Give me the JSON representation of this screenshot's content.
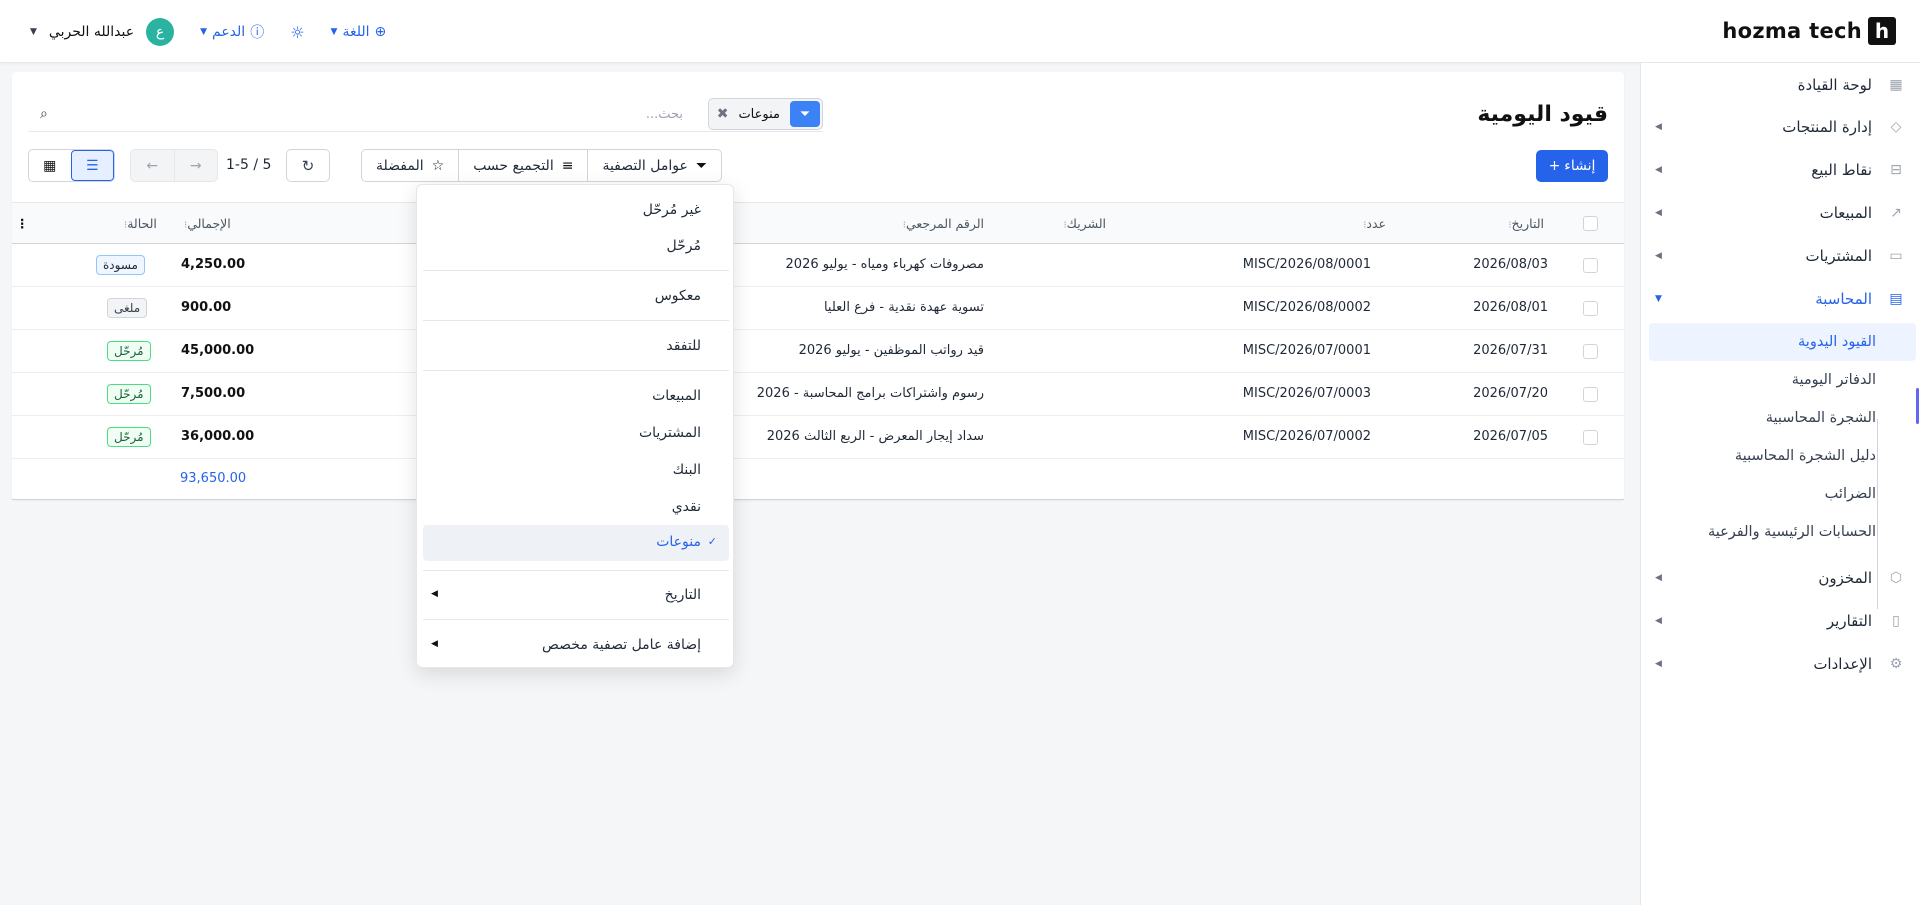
{
  "brand": {
    "name": "hozma tech",
    "mark": "h"
  },
  "topbar": {
    "user_name": "عبدالله الحربي",
    "avatar_letter": "ع",
    "support_label": "الدعم",
    "language_label": "اللغة"
  },
  "sidebar": {
    "items": [
      {
        "label": "لوحة القيادة",
        "icon": "dashboard-icon"
      },
      {
        "label": "إدارة المنتجات",
        "icon": "tag-icon"
      },
      {
        "label": "نقاط البيع",
        "icon": "store-icon"
      },
      {
        "label": "المبيعات",
        "icon": "chart-icon"
      },
      {
        "label": "المشتريات",
        "icon": "wallet-icon"
      },
      {
        "label": "المحاسبة",
        "icon": "ledger-icon"
      },
      {
        "label": "المخزون",
        "icon": "box-icon"
      },
      {
        "label": "التقارير",
        "icon": "report-icon"
      },
      {
        "label": "الإعدادات",
        "icon": "gear-icon"
      }
    ],
    "accounting_sub": [
      "القيود اليدوية",
      "الدفاتر اليومية",
      "الشجرة المحاسبية",
      "دليل الشجرة المحاسبية",
      "الضرائب",
      "الحسابات الرئيسية والفرعية"
    ]
  },
  "page": {
    "title": "قيود اليومية",
    "search_placeholder": "بحث...",
    "facet_value": "منوعات",
    "create_label": "إنشاء",
    "filters_label": "عوامل التصفية",
    "group_by_label": "التجميع حسب",
    "favorites_label": "المفضلة",
    "pager": "1-5 / 5"
  },
  "table": {
    "headers": {
      "date": "التاريخ",
      "number": "عدد",
      "partner": "الشريك",
      "ref": "الرقم المرجعي",
      "total": "الإجمالي",
      "status": "الحالة"
    },
    "rows": [
      {
        "date": "2026/08/03",
        "number": "MISC/2026/08/0001",
        "ref": "مصروفات كهرباء ومياه - يوليو 2026",
        "total": "4,250.00",
        "status": "مسودة",
        "status_kind": "draft"
      },
      {
        "date": "2026/08/01",
        "number": "MISC/2026/08/0002",
        "ref": "تسوية عهدة نقدية - فرع العليا",
        "total": "900.00",
        "status": "ملغى",
        "status_kind": "cancel"
      },
      {
        "date": "2026/07/31",
        "number": "MISC/2026/07/0001",
        "ref": "قيد رواتب الموظفين - يوليو 2026",
        "total": "45,000.00",
        "status": "مُرحّل",
        "status_kind": "posted"
      },
      {
        "date": "2026/07/20",
        "number": "MISC/2026/07/0003",
        "ref": "رسوم واشتراكات برامج المحاسبة - 2026",
        "total": "7,500.00",
        "status": "مُرحّل",
        "status_kind": "posted"
      },
      {
        "date": "2026/07/05",
        "number": "MISC/2026/07/0002",
        "ref": "سداد إيجار المعرض - الربع الثالث 2026",
        "total": "36,000.00",
        "status": "مُرحّل",
        "status_kind": "posted"
      }
    ],
    "grand_total": "93,650.00"
  },
  "filter_menu": {
    "items": [
      "غير مُرحّل",
      "مُرحّل",
      "معكوس",
      "للتفقد",
      "المبيعات",
      "المشتريات",
      "البنك",
      "نقدي",
      "منوعات",
      "التاريخ",
      "إضافة عامل تصفية مخصص"
    ],
    "selected": "منوعات"
  },
  "colors": {
    "accent": "#2563eb",
    "avatar": "#2bb3a1",
    "posted": "#4ade80"
  }
}
